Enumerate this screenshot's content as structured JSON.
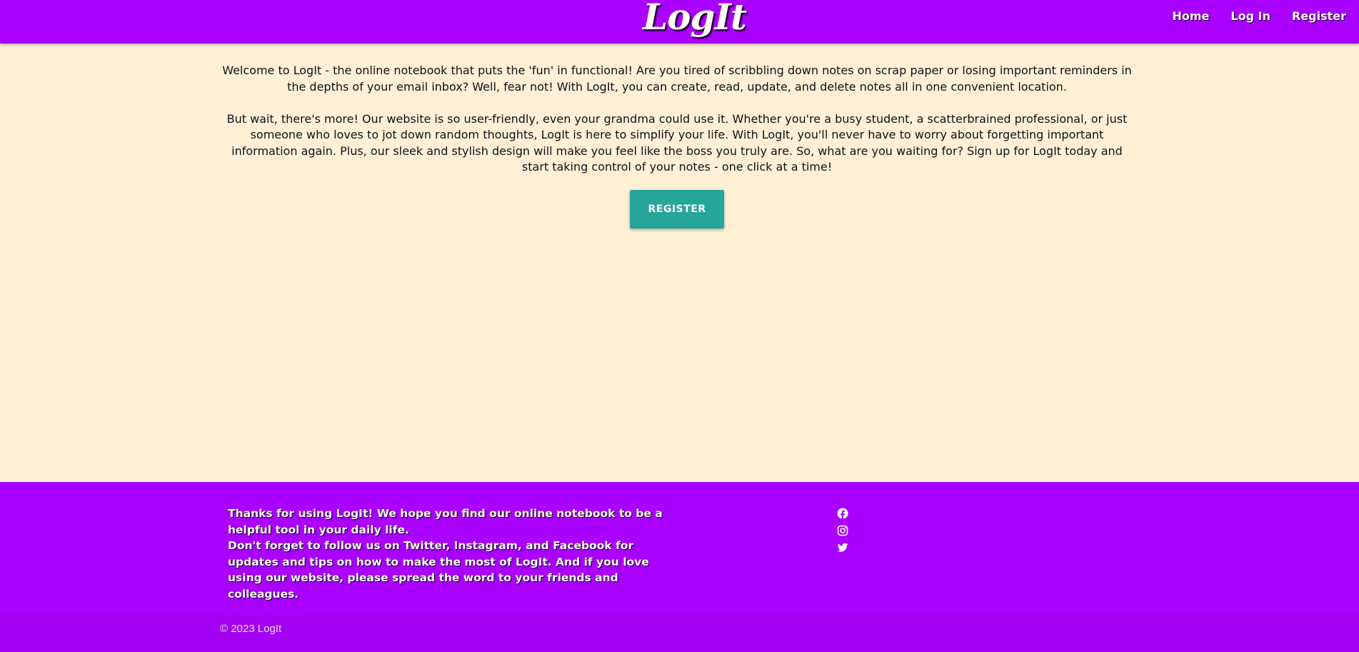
{
  "nav": {
    "brand": "LogIt",
    "links": [
      "Home",
      "Log In",
      "Register"
    ]
  },
  "main": {
    "paragraph1": "Welcome to LogIt - the online notebook that puts the 'fun' in functional! Are you tired of scribbling down notes on scrap paper or losing important reminders in the depths of your email inbox? Well, fear not! With LogIt, you can create, read, update, and delete notes all in one convenient location.",
    "paragraph2": "But wait, there's more! Our website is so user-friendly, even your grandma could use it. Whether you're a busy student, a scatterbrained professional, or just someone who loves to jot down random thoughts, LogIt is here to simplify your life. With LogIt, you'll never have to worry about forgetting important information again. Plus, our sleek and stylish design will make you feel like the boss you truly are. So, what are you waiting for? Sign up for LogIt today and start taking control of your notes - one click at a time!",
    "register_button": "REGISTER"
  },
  "footer": {
    "text1": "Thanks for using LogIt! We hope you find our online notebook to be a helpful tool in your daily life.",
    "text2": "Don't forget to follow us on Twitter, Instagram, and Facebook for updates and tips on how to make the most of LogIt. And if you love using our website, please spread the word to your friends and colleagues.",
    "social_icons": [
      "facebook-icon",
      "instagram-icon",
      "twitter-icon"
    ],
    "copyright": "© 2023 LogIt"
  },
  "colors": {
    "navbar": "#aa00ff",
    "page_background": "#fff0d6",
    "register_button": "#26a69a",
    "footer": "#aa00ff"
  }
}
